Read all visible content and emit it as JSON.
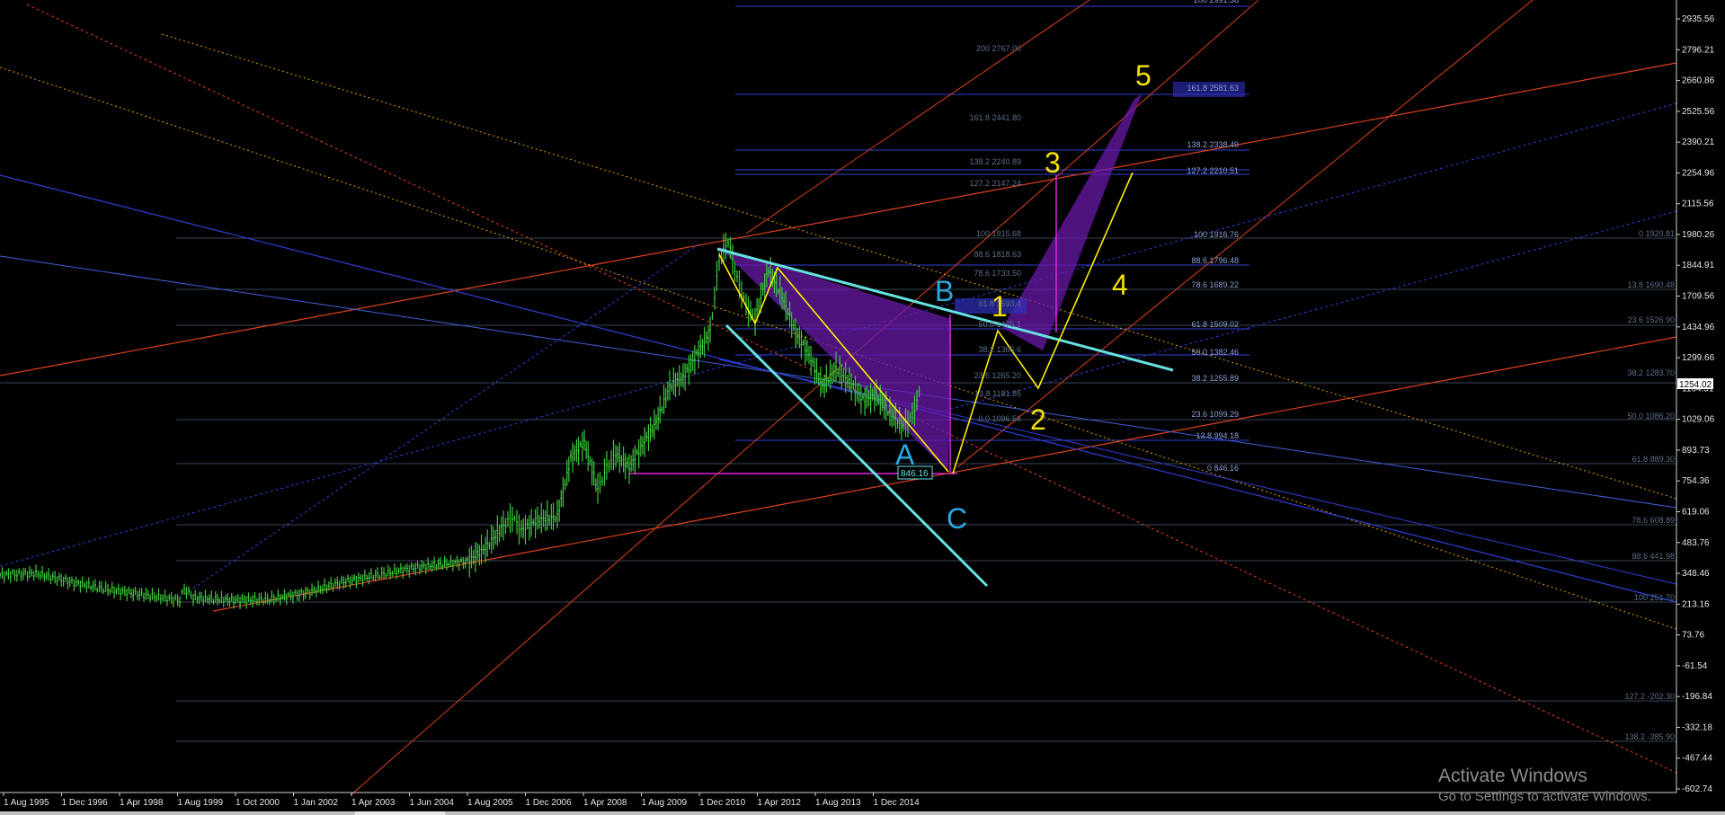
{
  "window": {
    "background": "#000000",
    "foreground": "#ffffff"
  },
  "colors": {
    "candle": "#3cc83c",
    "grid": "#3a4658",
    "fib_blue": "#2f3fd8",
    "fib_text": "#5a6f8a",
    "fib_text_bright": "#8aa0d8",
    "red_line": "#e0401c",
    "cyan": "#66e0e0",
    "yellow": "#ffee00",
    "magenta": "#e020e0",
    "purple_fill": "#6a1aa8",
    "wave_label_blue": "#2aa8e0",
    "wave_label_yellow": "#f5e000"
  },
  "price_axis": {
    "labels": [
      "2935.56",
      "2796.21",
      "2660.86",
      "2525.56",
      "2390.21",
      "2254.96",
      "2115.56",
      "1980.26",
      "1844.91",
      "1709.56",
      "1434.96",
      "1299.66",
      "1164.31",
      "1029.06",
      "893.73",
      "754.36",
      "619.06",
      "483.76",
      "348.46",
      "213.16",
      "73.76",
      "-61.54",
      "-196.84",
      "-332.18",
      "-467.44",
      "-602.74"
    ],
    "current_price": "1254.02"
  },
  "time_axis": {
    "labels": [
      "1 Aug 1995",
      "1 Dec 1996",
      "1 Apr 1998",
      "1 Aug 1999",
      "1 Oct 2000",
      "1 Jan 2002",
      "1 Apr 2003",
      "1 Jun 2004",
      "1 Aug 2005",
      "1 Dec 2006",
      "1 Apr 2008",
      "1 Aug 2009",
      "1 Dec 2010",
      "1 Apr 2012",
      "1 Aug 2013",
      "1 Dec 2014"
    ]
  },
  "fib_levels": {
    "set1": [
      "200 2767.00",
      "161.8 2441.80",
      "138.2 2240.89",
      "127.2 2147.24",
      "100 1915.68",
      "88.6 1818.63",
      "78.6 1733.50",
      "61.8 1593.4",
      "50.0 1475.1",
      "38.2 1365.6",
      "23.6 1265.20",
      "13.8 1181.85",
      "0.0 1096.56"
    ],
    "set2": [
      "200 2991.38",
      "161.8 2581.63",
      "138.2 2338.49",
      "127.2 2210.51",
      "100 1916.76",
      "88.6 1796.48",
      "78.6 1689.22",
      "61.8 1509.02",
      "50.0 1382.46",
      "38.2 1255.89",
      "23.6 1099.29",
      "13.8 994.18",
      "0 846.16"
    ],
    "set3": [
      "0 1920.81",
      "13.8 1690.48",
      "23.6 1526.90",
      "38.2 1283.70",
      "50.0 1086.20",
      "61.8 889.30",
      "78.6 608.89",
      "88.6 441.98",
      "100 251.70",
      "127.2 -202.30",
      "138.2 -385.90"
    ]
  },
  "price_callout": "846.16",
  "wave_labels": {
    "A": "A",
    "B": "B",
    "C": "C",
    "w1": "1",
    "w2": "2",
    "w3": "3",
    "w4": "4",
    "w5": "5"
  },
  "watermark": {
    "title": "Activate Windows",
    "subtitle": "Go to Settings to activate Windows."
  }
}
